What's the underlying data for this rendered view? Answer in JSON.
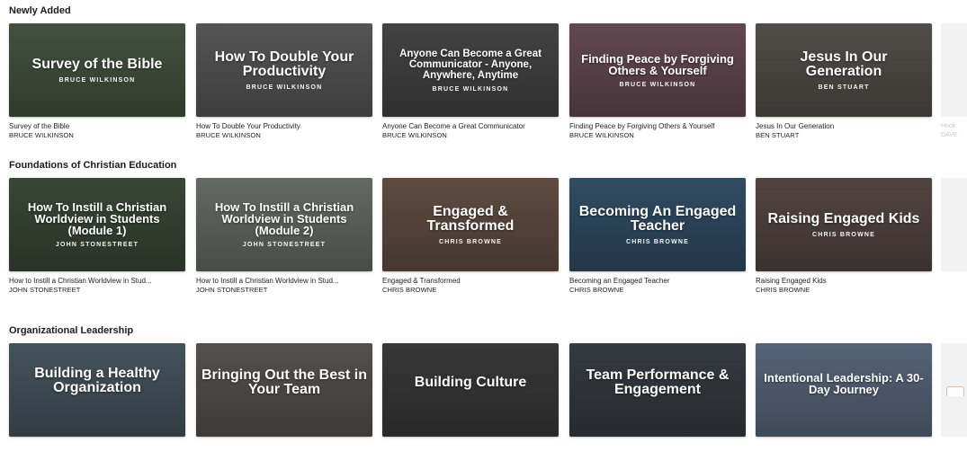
{
  "sections": [
    {
      "title": "Newly Added",
      "cards": [
        {
          "thumb_title": "Survey of the Bible",
          "thumb_author": "BRUCE WILKINSON",
          "title": "Survey of the Bible",
          "author": "BRUCE WILKINSON",
          "bg": "#4b5a44"
        },
        {
          "thumb_title": "How To Double Your Productivity",
          "thumb_author": "BRUCE WILKINSON",
          "title": "How To Double Your Productivity",
          "author": "BRUCE WILKINSON",
          "bg": "#5e5e5e"
        },
        {
          "thumb_title": "Anyone Can Become a Great Communicator - Anyone, Anywhere, Anytime",
          "thumb_author": "BRUCE WILKINSON",
          "title": "Anyone Can Become a Great Communicator",
          "author": "BRUCE WILKINSON",
          "bg": "#4a4a4a"
        },
        {
          "thumb_title": "Finding Peace by Forgiving Others & Yourself",
          "thumb_author": "BRUCE WILKINSON",
          "title": "Finding Peace by Forgiving Others & Yourself",
          "author": "BRUCE WILKINSON",
          "bg": "#6e4f5a"
        },
        {
          "thumb_title": "Jesus In Our Generation",
          "thumb_author": "BEN STUART",
          "title": "Jesus In Our Generation",
          "author": "BEN STUART",
          "bg": "#5a5650"
        }
      ],
      "peek_title": "Hook",
      "peek_author": "DAVE"
    },
    {
      "title": "Foundations of Christian Education",
      "cards": [
        {
          "thumb_title": "How To Instill a Christian Worldview in Students (Module 1)",
          "thumb_author": "JOHN STONESTREET",
          "title": "How to Instill a Christian Worldview in Stud...",
          "author": "JOHN STONESTREET",
          "bg": "#3f4e3c"
        },
        {
          "thumb_title": "How To Instill a Christian Worldview in Students (Module 2)",
          "thumb_author": "JOHN STONESTREET",
          "title": "How to Instill a Christian Worldview in Stud...",
          "author": "JOHN STONESTREET",
          "bg": "#6f7570"
        },
        {
          "thumb_title": "Engaged & Transformed",
          "thumb_author": "CHRIS BROWNE",
          "title": "Engaged & Transformed",
          "author": "CHRIS BROWNE",
          "bg": "#6a5448"
        },
        {
          "thumb_title": "Becoming An Engaged Teacher",
          "thumb_author": "CHRIS BROWNE",
          "title": "Becoming an Engaged Teacher",
          "author": "CHRIS BROWNE",
          "bg": "#35546e"
        },
        {
          "thumb_title": "Raising Engaged Kids",
          "thumb_author": "CHRIS BROWNE",
          "title": "Raising Engaged Kids",
          "author": "CHRIS BROWNE",
          "bg": "#5a4c48"
        }
      ]
    },
    {
      "title": "Organizational Leadership",
      "cards": [
        {
          "thumb_title": "Building a Healthy Organization",
          "thumb_author": "",
          "title": "",
          "author": "",
          "bg": "#4c5c66"
        },
        {
          "thumb_title": "Bringing Out the Best in Your Team",
          "thumb_author": "",
          "title": "",
          "author": "",
          "bg": "#5c5a56"
        },
        {
          "thumb_title": "Building Culture",
          "thumb_author": "",
          "title": "",
          "author": "",
          "bg": "#3e3e3e"
        },
        {
          "thumb_title": "Team Performance & Engagement",
          "thumb_author": "",
          "title": "",
          "author": "",
          "bg": "#3b4148"
        },
        {
          "thumb_title": "Intentional Leadership: A 30-Day Journey",
          "thumb_author": "",
          "title": "",
          "author": "",
          "bg": "#5f6f86"
        }
      ]
    }
  ]
}
